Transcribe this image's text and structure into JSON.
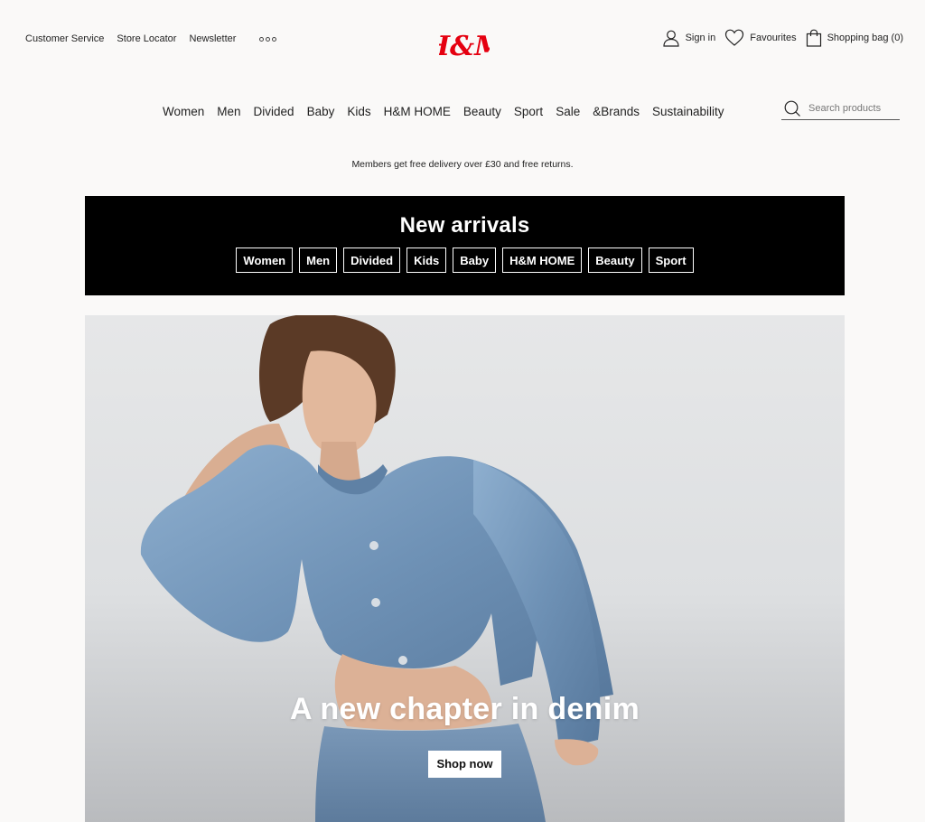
{
  "header": {
    "utility_links": [
      "Customer Service",
      "Store Locator",
      "Newsletter"
    ],
    "more_icon": "more-dots-icon",
    "logo_text": "H&M",
    "brand_color": "#e50010",
    "account": {
      "sign_in": "Sign in",
      "favourites": "Favourites",
      "shopping_bag": "Shopping bag (0)"
    }
  },
  "nav": {
    "items": [
      "Women",
      "Men",
      "Divided",
      "Baby",
      "Kids",
      "H&M HOME",
      "Beauty",
      "Sport",
      "Sale",
      "&Brands",
      "Sustainability"
    ]
  },
  "search": {
    "placeholder": "Search products",
    "icon": "search-icon"
  },
  "promo": {
    "text": "Members get free delivery over £30 and free returns."
  },
  "new_arrivals": {
    "title": "New arrivals",
    "chips": [
      "Women",
      "Men",
      "Divided",
      "Kids",
      "Baby",
      "H&M HOME",
      "Beauty",
      "Sport"
    ]
  },
  "hero": {
    "title": "A new chapter in denim",
    "cta": "Shop now"
  }
}
